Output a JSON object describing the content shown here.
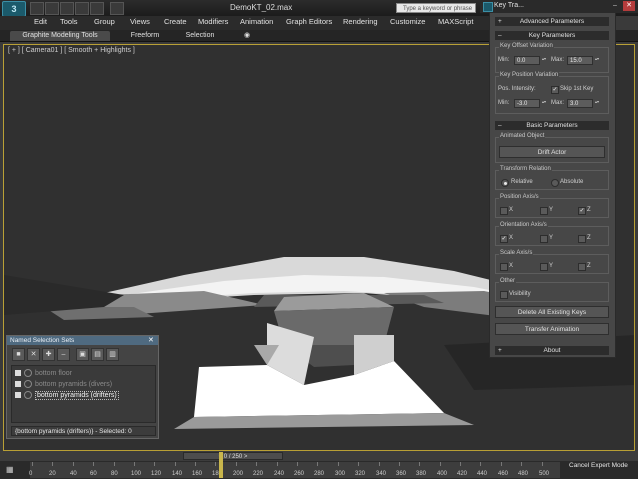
{
  "app": {
    "title": "DemoKT_02.max",
    "logo_text": "3",
    "search_placeholder": "Type a keyword or phrase"
  },
  "menubar": [
    "Edit",
    "Tools",
    "Group",
    "Views",
    "Create",
    "Modifiers",
    "Animation",
    "Graph Editors",
    "Rendering",
    "Customize",
    "MAXScript"
  ],
  "ribbon": {
    "tabs": [
      "Graphite Modeling Tools",
      "Freeform",
      "Selection"
    ]
  },
  "viewport": {
    "label": "[ + ] [ Camera01 ] [ Smooth + Highlights ]"
  },
  "key_tracker": {
    "title": "Key Tra...",
    "sections": {
      "advanced": "Advanced Parameters",
      "key": "Key Parameters",
      "basic": "Basic Parameters",
      "about": "About"
    },
    "key_offset": {
      "title": "Key Offset Variation",
      "min_label": "Min:",
      "min_value": "0.0",
      "max_label": "Max:",
      "max_value": "15.0"
    },
    "key_position": {
      "title": "Key Position Variation",
      "intensity_label": "Pos. Intensity:",
      "skip_label": "Skip 1st Key",
      "skip_checked": true,
      "min_label": "Min:",
      "min_value": "-3.0",
      "max_label": "Max:",
      "max_value": "3.0"
    },
    "animated_object": {
      "title": "Animated Object",
      "button": "Drift Actor"
    },
    "transform_relation": {
      "title": "Transform Relation",
      "relative": "Relative",
      "absolute": "Absolute",
      "selected": "relative"
    },
    "position_axis": {
      "title": "Position Axis/s",
      "x": "X",
      "y": "Y",
      "z": "Z",
      "checked": [
        "z"
      ]
    },
    "orientation_axis": {
      "title": "Orientation Axis/s",
      "x": "X",
      "y": "Y",
      "z": "Z",
      "checked": [
        "x"
      ]
    },
    "scale_axis": {
      "title": "Scale Axis/s",
      "x": "X",
      "y": "Y",
      "z": "Z",
      "checked": []
    },
    "other": {
      "title": "Other",
      "visibility": "Visibility"
    },
    "buttons": {
      "delete_keys": "Delete All Existing Keys",
      "transfer": "Transfer Animation"
    }
  },
  "selection_sets": {
    "title": "Named Selection Sets",
    "items": [
      {
        "label": "bottom floor"
      },
      {
        "label": "bottom pyramids (divers)"
      },
      {
        "label": "bottom pyramids (drifters)"
      }
    ],
    "status": "{bottom pyramids (drifters)} - Selected: 0"
  },
  "timeline": {
    "slider": "< 0 / 250 >",
    "ticks": [
      "0",
      "20",
      "40",
      "60",
      "80",
      "100",
      "120",
      "140",
      "160",
      "180",
      "200",
      "220",
      "240",
      "260",
      "280",
      "300",
      "320",
      "340",
      "360",
      "380",
      "400",
      "420",
      "440",
      "460",
      "480",
      "500"
    ],
    "cancel_label": "Cancel Expert Mode"
  },
  "colors": {
    "accent_border": "#b9a035",
    "panel": "#474747",
    "selection_title": "#4f6a80"
  }
}
